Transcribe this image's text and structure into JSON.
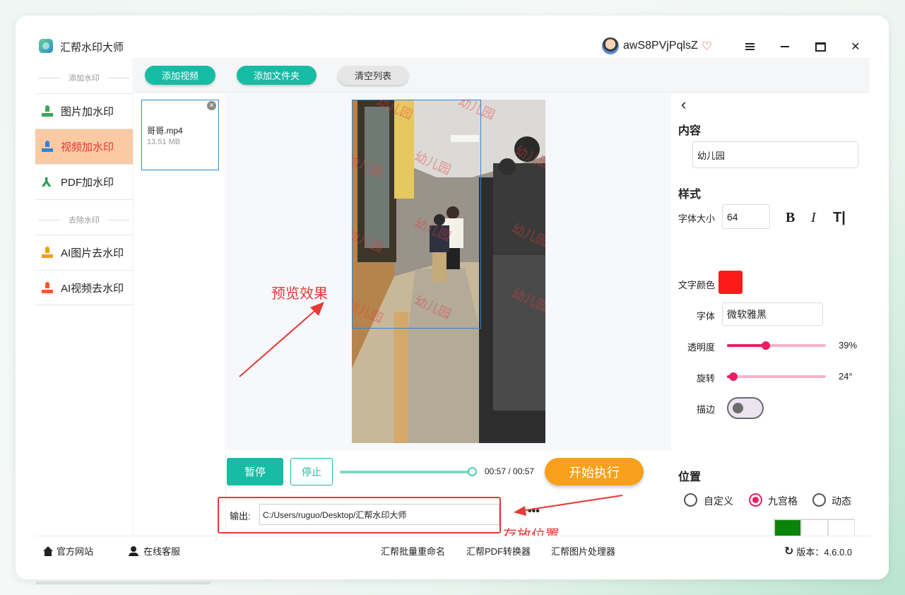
{
  "app": {
    "title": "汇帮水印大师",
    "username": "awS8PVjPqlsZ"
  },
  "sidebar": {
    "add_header": "添加水印",
    "remove_header": "去除水印",
    "items": [
      {
        "label": "图片加水印"
      },
      {
        "label": "视频加水印"
      },
      {
        "label": "PDF加水印"
      },
      {
        "label": "AI图片去水印"
      },
      {
        "label": "AI视频去水印"
      }
    ]
  },
  "toolbar": {
    "add_video": "添加视频",
    "add_folder": "添加文件夹",
    "clear": "清空列表"
  },
  "file": {
    "name": "哥哥.mp4",
    "size": "13.51 MB"
  },
  "preview": {
    "annotation": "预览效果",
    "watermark_text": "幼儿园"
  },
  "controls": {
    "pause": "暂停",
    "stop": "停止",
    "time": "00:57 / 00:57",
    "progress": 1.0,
    "start": "开始执行",
    "output_label": "输出:",
    "output_path": "C:/Users/ruguo/Desktop/汇帮水印大师",
    "more": "•••",
    "store_annotation": "存放位置"
  },
  "panel": {
    "content_title": "内容",
    "content_value": "幼儿园",
    "style_title": "样式",
    "font_size_label": "字体大小",
    "font_size": "64",
    "bold": "B",
    "italic": "I",
    "tt": "T|",
    "color_label": "文字颜色",
    "text_color": "#ff1a1a",
    "font_label": "字体",
    "font_value": "微软雅黑",
    "opacity_label": "透明度",
    "opacity_value": "39%",
    "opacity": 0.39,
    "rotation_label": "旋转",
    "rotation_value": "24°",
    "rotation": 24,
    "stroke_label": "描边",
    "stroke_on": false,
    "position_title": "位置",
    "position_options": [
      "自定义",
      "九宫格",
      "动态"
    ],
    "position_selected": "九宫格",
    "grid_selected_cell": 0
  },
  "footer": {
    "website": "官方网站",
    "service": "在线客服",
    "rename": "汇帮批量重命名",
    "pdf": "汇帮PDF转换器",
    "image": "汇帮图片处理器",
    "version": "版本：4.6.0.0"
  },
  "colors": {
    "accent": "#16bca4",
    "start": "#f8a01c",
    "active_nav": "#fbc9a3",
    "annotation": "#e53935"
  }
}
